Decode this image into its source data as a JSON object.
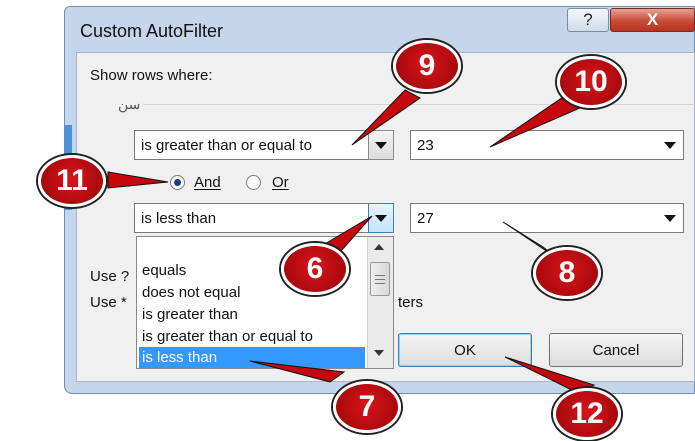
{
  "window": {
    "title": "Custom AutoFilter",
    "help_glyph": "?",
    "close_glyph": "X"
  },
  "dialog": {
    "show_rows_label": "Show rows where:",
    "field_label": "سن",
    "condition1": {
      "operator": "is greater than or equal to",
      "value": "23"
    },
    "logic": {
      "and_label": "And",
      "or_label": "Or",
      "selected": "And"
    },
    "condition2": {
      "operator": "is less than",
      "value": "27"
    },
    "hint1_prefix": "Use ?",
    "hint2_prefix": "Use *",
    "hint2_suffix": "ters",
    "dropdown_options": [
      "equals",
      "does not equal",
      "is greater than",
      "is greater than or equal to",
      "is less than"
    ],
    "dropdown_selected": "is less than",
    "ok_label": "OK",
    "cancel_label": "Cancel"
  },
  "callouts": [
    "9",
    "10",
    "11",
    "6",
    "8",
    "7",
    "12"
  ],
  "colors": {
    "badge": "#c4080e",
    "selection": "#3399ff",
    "frame": "#c5d6ec"
  }
}
